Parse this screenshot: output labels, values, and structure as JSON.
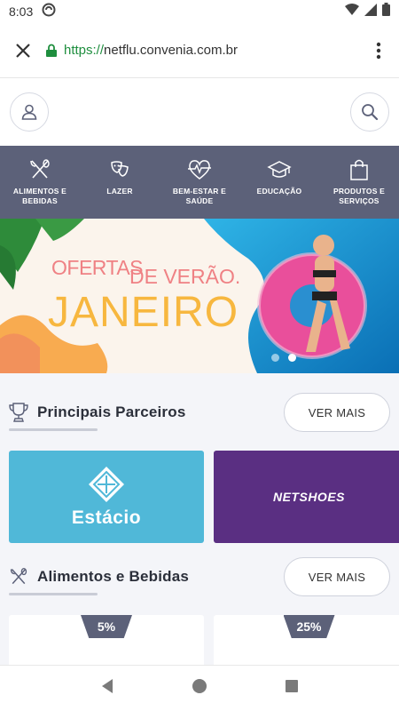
{
  "status": {
    "time": "8:03"
  },
  "browser": {
    "url_scheme": "https://",
    "url_host": "netflu.convenia.com.br"
  },
  "categories": [
    {
      "label_line1": "ALIMENTOS E",
      "label_line2": "BEBIDAS",
      "icon": "fork-knife-icon"
    },
    {
      "label_line1": "LAZER",
      "label_line2": "",
      "icon": "theater-masks-icon"
    },
    {
      "label_line1": "BEM-ESTAR E",
      "label_line2": "SAÚDE",
      "icon": "heart-pulse-icon"
    },
    {
      "label_line1": "EDUCAÇÃO",
      "label_line2": "",
      "icon": "graduation-cap-icon"
    },
    {
      "label_line1": "PRODUTOS E",
      "label_line2": "SERVIÇOS",
      "icon": "shopping-bag-icon"
    }
  ],
  "banner": {
    "line1a": "OFERTAS",
    "line1b": "DE VERÃO.",
    "line2": "JANEIRO",
    "slides": 2,
    "active_slide": 2
  },
  "sections": {
    "partners": {
      "title": "Principais Parceiros",
      "ver_mais": "VER MAIS"
    },
    "food": {
      "title": "Alimentos e Bebidas",
      "ver_mais": "VER MAIS"
    }
  },
  "partners": [
    {
      "name": "Estácio",
      "color": "#50b8d8"
    },
    {
      "name": "NETSHOES",
      "color": "#5a2f82"
    }
  ],
  "offers": [
    {
      "discount": "5%"
    },
    {
      "discount": "25%"
    }
  ],
  "colors": {
    "nav_bg": "#5c6179",
    "banner_pink": "#ef8184",
    "banner_yellow": "#f7b73f",
    "content_bg": "#f4f5f9"
  }
}
